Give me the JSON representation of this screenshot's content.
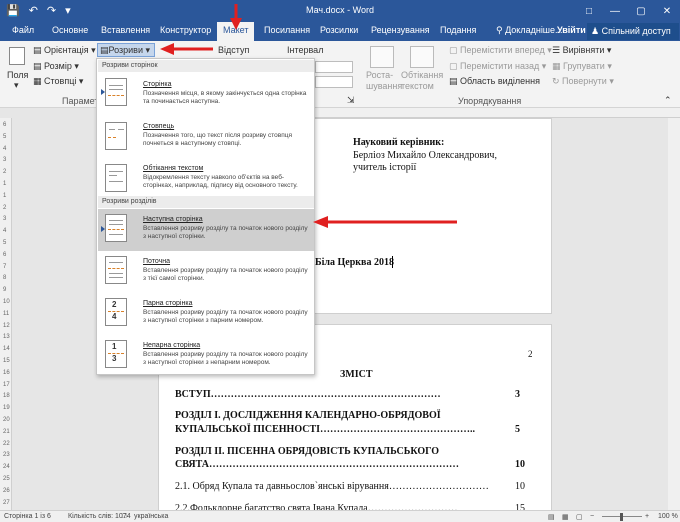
{
  "title_bar": {
    "save_icon": "save-icon",
    "undo_icon": "undo-icon",
    "redo_icon": "redo-icon",
    "doc_title": "Мач.docx - Word"
  },
  "tabs": [
    "Файл",
    "Основне",
    "Вставлення",
    "Конструктор",
    "Макет",
    "Посилання",
    "Розсилки",
    "Рецензування",
    "Подання"
  ],
  "help": "Докладніше...",
  "signin": "Увійти",
  "share": "Спільний доступ",
  "ribbon": {
    "fields": "Поля",
    "orientation": "Орієнтація",
    "size": "Розмір",
    "columns": "Стовпці",
    "breaks": "Розриви",
    "indent": "Відступ",
    "spacing": "Інтервал",
    "group_page_setup": "Параметр",
    "position": "Роста-\nшування",
    "wrap": "Обтікання\nтекстом",
    "bring_forward": "Перемістити вперед",
    "send_backward": "Перемістити назад",
    "selection_pane": "Область виділення",
    "align": "Вирівняти",
    "group": "Групувати",
    "rotate": "Повернути",
    "group_arrange": "Упорядкування"
  },
  "dropdown": {
    "header_page": "Розриви сторінок",
    "header_section": "Розриви розділів",
    "items": [
      {
        "title": "Сторінка",
        "desc": "Позначення місця, в якому закінчується одна сторінка та починається наступна."
      },
      {
        "title": "Стовпець",
        "desc": "Позначення того, що текст після розриву стовпця почнеться в наступному стовпці."
      },
      {
        "title": "Обтікання текстом",
        "desc": "Відокремлення тексту навколо об'єктів на веб-сторінках, наприклад, підпису від основного тексту."
      },
      {
        "title": "Наступна сторінка",
        "desc": "Вставлення розриву розділу та початок нового розділу з наступної сторінки."
      },
      {
        "title": "Поточна",
        "desc": "Вставлення розриву розділу та початок нового розділу з тієї самої сторінки."
      },
      {
        "title": "Парна сторінка",
        "desc": "Вставлення розриву розділу та початок нового розділу з наступної сторінки з парним номером."
      },
      {
        "title": "Непарна сторінка",
        "desc": "Вставлення розриву розділу та початок нового розділу з наступної сторінки з непарним номером."
      }
    ]
  },
  "page1": {
    "supervisor_label": "Науковий керівник:",
    "supervisor_name": "Берліоз Михайло Олександрович,",
    "supervisor_role": "учитель історії",
    "city_year": "Біла Церква 2018"
  },
  "page2": {
    "page_number": "2",
    "heading": "ЗМІСТ",
    "toc": [
      {
        "text": "ВСТУП……………………………………………………………",
        "page": "3"
      },
      {
        "text": "РОЗДІЛ І.  ДОСЛІДЖЕННЯ  КАЛЕНДАРНО-ОБРЯДОВОЇ",
        "page": ""
      },
      {
        "text": "КУПАЛЬСЬКОЇ ПІСЕННОСТІ………………………………………..",
        "page": "5"
      },
      {
        "text": "РОЗДІЛ    ІІ.    ПІСЕННА    ОБРЯДОВІСТЬ    КУПАЛЬСЬКОГО",
        "page": ""
      },
      {
        "text": "СВЯТА…………………………………………………………………",
        "page": "10"
      },
      {
        "text": "2.1. Обряд Купала та давньослов`янські вірування…………………………",
        "page": "10"
      },
      {
        "text": "2.2.Фольклорне багатство  свята  Івана Купала………………………",
        "page": "15"
      }
    ]
  },
  "status": {
    "page": "Сторінка 1 із 6",
    "words": "Кількість слів: 1074",
    "language": "українська",
    "zoom": "100 %"
  },
  "ruler_left": [
    "6",
    "5",
    "4",
    "3",
    "2",
    "1",
    "1",
    "2",
    "3",
    "4",
    "5",
    "6",
    "7",
    "8",
    "9",
    "10",
    "11",
    "12",
    "13",
    "14",
    "15",
    "16",
    "17",
    "18",
    "19",
    "20",
    "21",
    "22",
    "23",
    "24",
    "25",
    "26",
    "27"
  ],
  "colors": {
    "accent": "#2b579a",
    "arrow": "#e02020"
  }
}
